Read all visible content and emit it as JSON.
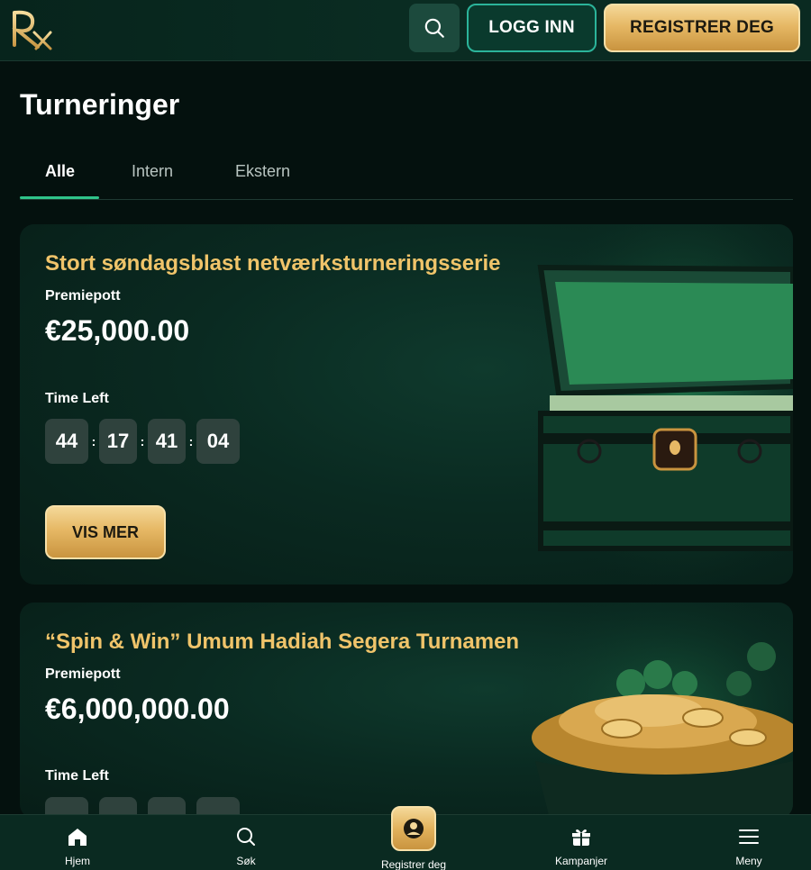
{
  "header": {
    "logo_text": "RX",
    "login_label": "LOGG INN",
    "register_label": "REGISTRER DEG",
    "search_icon": "search-icon"
  },
  "page": {
    "title": "Turneringer"
  },
  "tabs": [
    {
      "label": "Alle",
      "active": true
    },
    {
      "label": "Intern",
      "active": false
    },
    {
      "label": "Ekstern",
      "active": false
    }
  ],
  "tournaments": [
    {
      "title": "Stort søndagsblast netværksturneringsserie",
      "prize_label": "Premiepott",
      "prize": "€25,000.00",
      "time_label": "Time Left",
      "timer": [
        "44",
        "17",
        "41",
        "04"
      ],
      "button_label": "VIS MER",
      "art": "treasure-chest"
    },
    {
      "title": "“Spin & Win” Umum Hadiah Segera Turnamen",
      "prize_label": "Premiepott",
      "prize": "€6,000,000.00",
      "time_label": "Time Left",
      "art": "pot-of-gold"
    }
  ],
  "bottom_nav": [
    {
      "label": "Hjem",
      "icon": "home-icon"
    },
    {
      "label": "Søk",
      "icon": "search-icon"
    },
    {
      "label": "Registrer deg",
      "icon": "user-icon"
    },
    {
      "label": "Kampanjer",
      "icon": "gift-icon"
    },
    {
      "label": "Meny",
      "icon": "menu-icon"
    }
  ],
  "colors": {
    "accent_gold": "#f0c46a",
    "accent_green": "#2fc48a",
    "background": "#04110e"
  }
}
